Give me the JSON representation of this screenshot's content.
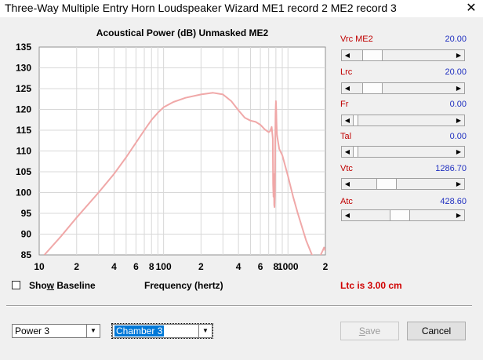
{
  "window": {
    "title": "Three-Way Multiple Entry Horn Loudspeaker Wizard    ME1 record 2    ME2 record 3",
    "close_glyph": "✕"
  },
  "chart_data": {
    "type": "line",
    "title": "Acoustical Power (dB)   Unmasked   ME2",
    "xlabel": "Frequency (hertz)",
    "ylabel": "",
    "x_scale": "log",
    "xlim": [
      10,
      2000
    ],
    "ylim": [
      85,
      135
    ],
    "yticks": [
      85,
      90,
      95,
      100,
      105,
      110,
      115,
      120,
      125,
      130,
      135
    ],
    "xtick_labels": [
      {
        "x": 10,
        "label": "10"
      },
      {
        "x": 20,
        "label": "2"
      },
      {
        "x": 40,
        "label": "4"
      },
      {
        "x": 60,
        "label": "6"
      },
      {
        "x": 80,
        "label": "8"
      },
      {
        "x": 100,
        "label": "100"
      },
      {
        "x": 200,
        "label": "2"
      },
      {
        "x": 400,
        "label": "4"
      },
      {
        "x": 600,
        "label": "6"
      },
      {
        "x": 800,
        "label": "8"
      },
      {
        "x": 1000,
        "label": "1000"
      },
      {
        "x": 2000,
        "label": "2"
      }
    ],
    "grid": true,
    "line_color": "#f0a8a8",
    "series": [
      {
        "x": [
          11,
          15,
          20,
          30,
          40,
          50,
          60,
          70,
          80,
          90,
          100,
          120,
          150,
          200,
          250,
          300,
          350,
          400,
          450,
          500,
          550,
          600,
          650,
          700,
          720,
          740,
          755,
          760,
          765,
          770,
          775,
          780,
          785,
          790,
          795,
          800,
          805,
          810,
          815,
          820,
          830,
          850,
          900,
          1000,
          1100,
          1200,
          1400,
          1560,
          1650,
          1800,
          1900,
          1950,
          2000
        ],
        "y": [
          85,
          89.5,
          94,
          100,
          104.5,
          108.5,
          112,
          115,
          117.5,
          119.2,
          120.5,
          121.8,
          122.8,
          123.6,
          124,
          123.6,
          122,
          119.8,
          118,
          117.3,
          117,
          116.3,
          115.2,
          114.5,
          114.8,
          115.8,
          113,
          102,
          99,
          104.5,
          97,
          96.5,
          100,
          112,
          119,
          122,
          120,
          116.5,
          114,
          113.5,
          112.5,
          110.5,
          109,
          104,
          99,
          95,
          88.5,
          85,
          84.5,
          84.5,
          86,
          86.8,
          86
        ]
      }
    ]
  },
  "sliders": [
    {
      "label": "Vrc  ME2",
      "value": "20.00",
      "pos": 0.12
    },
    {
      "label": "Lrc",
      "value": "20.00",
      "pos": 0.12
    },
    {
      "label": "Fr",
      "value": "0.00",
      "pos": 0.0
    },
    {
      "label": "Tal",
      "value": "0.00",
      "pos": 0.0
    },
    {
      "label": "Vtc",
      "value": "1286.70",
      "pos": 0.29
    },
    {
      "label": "Atc",
      "value": "428.60",
      "pos": 0.46
    }
  ],
  "show_baseline_label": "Show Baseline",
  "status": "Ltc is 3.00 cm",
  "power_select": "Power 3",
  "chamber_select": "Chamber 3",
  "save_label": "Save",
  "cancel_label": "Cancel"
}
